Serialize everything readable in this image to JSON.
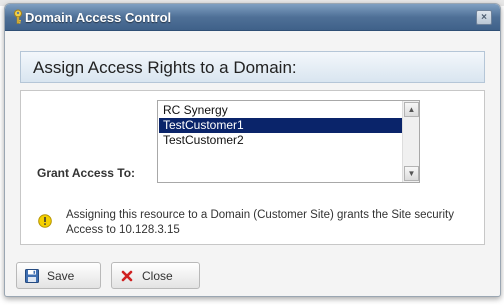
{
  "window": {
    "title": "Domain Access Control",
    "close_glyph": "×"
  },
  "banner": {
    "heading": "Assign Access Rights to a Domain:"
  },
  "form": {
    "grant_label": "Grant Access To:",
    "domains": [
      {
        "label": "RC Synergy",
        "selected": false
      },
      {
        "label": "TestCustomer1",
        "selected": true
      },
      {
        "label": "TestCustomer2",
        "selected": false
      }
    ],
    "info_text": "Assigning this resource to a Domain (Customer Site) grants the Site security Access to 10.128.3.15"
  },
  "buttons": {
    "save_label": "Save",
    "close_label": "Close"
  },
  "colors": {
    "titlebar": "#4f7097",
    "selection": "#0a246a",
    "info_icon": "#f5d000"
  },
  "icons": {
    "title": "key-icon",
    "info": "warning-icon",
    "save": "floppy-disk-icon",
    "close": "red-x-icon"
  }
}
